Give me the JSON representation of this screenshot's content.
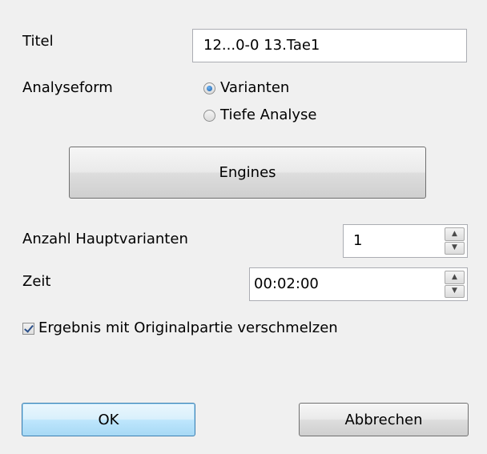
{
  "fields": {
    "titel_label": "Titel",
    "titel_value": "12...0-0 13.Tae1",
    "analyseform_label": "Analyseform",
    "radio_options": [
      "Varianten",
      "Tiefe Analyse"
    ],
    "radio_selected": "Varianten",
    "engines_button": "Engines",
    "hauptvarianten_label": "Anzahl Hauptvarianten",
    "hauptvarianten_value": "1",
    "zeit_label": "Zeit",
    "zeit_value": "00:02:00",
    "merge_checkbox_label": "Ergebnis mit Originalpartie verschmelzen",
    "merge_checked": true
  },
  "buttons": {
    "ok": "OK",
    "cancel": "Abbrechen"
  },
  "icons": {
    "spin_up": "▲",
    "spin_down": "▼"
  },
  "colors": {
    "background": "#f0f0f0",
    "default_button_border": "#3c7fb1",
    "radio_dot": "#1d5fa8"
  }
}
